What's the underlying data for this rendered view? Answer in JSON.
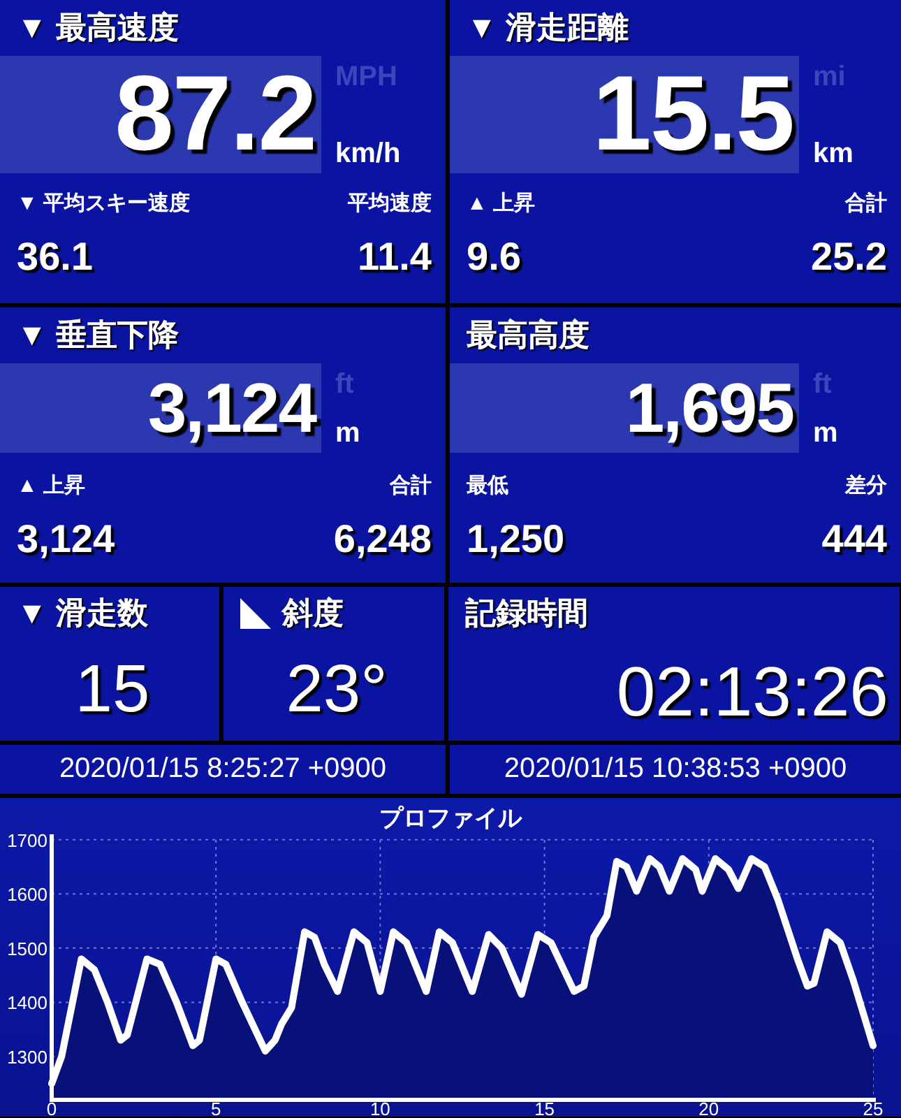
{
  "panels": [
    {
      "title": "▼ 最高速度",
      "value": "87.2",
      "alt_unit": "MPH",
      "unit": "km/h",
      "stats": [
        {
          "label": "▼ 平均スキー速度",
          "value": "36.1"
        },
        {
          "label": "平均速度",
          "value": "11.4"
        }
      ]
    },
    {
      "title": "▼ 滑走距離",
      "value": "15.5",
      "alt_unit": "mi",
      "unit": "km",
      "stats": [
        {
          "label": "▲ 上昇",
          "value": "9.6"
        },
        {
          "label": "合計",
          "value": "25.2"
        }
      ]
    },
    {
      "title": "▼ 垂直下降",
      "value": "3,124",
      "alt_unit": "ft",
      "unit": "m",
      "stats": [
        {
          "label": "▲ 上昇",
          "value": "3,124"
        },
        {
          "label": "合計",
          "value": "6,248"
        }
      ]
    },
    {
      "title": "最高高度",
      "value": "1,695",
      "alt_unit": "ft",
      "unit": "m",
      "stats": [
        {
          "label": "最低",
          "value": "1,250"
        },
        {
          "label": "差分",
          "value": "444"
        }
      ]
    }
  ],
  "small_panels": [
    {
      "kind": "count",
      "title": "▼ 滑走数",
      "value": "15"
    },
    {
      "kind": "slope",
      "title": "斜度",
      "value": "23°"
    },
    {
      "kind": "time",
      "title": "記録時間",
      "value": "02:13:26"
    }
  ],
  "timestamps": [
    "2020/01/15 8:25:27 +0900",
    "2020/01/15 10:38:53 +0900"
  ],
  "profile": {
    "chart_data": {
      "type": "area",
      "title": "プロファイル",
      "x": [
        0,
        0.3,
        0.9,
        1.3,
        1.7,
        2.1,
        2.3,
        2.9,
        3.3,
        3.8,
        4.3,
        4.5,
        5.0,
        5.3,
        5.8,
        6.5,
        6.8,
        7.0,
        7.3,
        7.7,
        8.0,
        8.3,
        8.7,
        9.2,
        9.6,
        10.0,
        10.4,
        10.8,
        11.4,
        11.8,
        12.2,
        12.8,
        13.3,
        13.7,
        14.3,
        14.8,
        15.2,
        15.9,
        16.2,
        16.5,
        16.9,
        17.2,
        17.5,
        17.8,
        18.2,
        18.5,
        18.8,
        19.2,
        19.6,
        19.8,
        20.2,
        20.6,
        20.9,
        21.3,
        21.7,
        22.1,
        22.7,
        23.0,
        23.2,
        23.6,
        24.0,
        24.4,
        25.0
      ],
      "series": [
        {
          "color": "#ffffff",
          "values": [
            1250,
            1300,
            1480,
            1460,
            1400,
            1330,
            1340,
            1480,
            1470,
            1400,
            1320,
            1330,
            1480,
            1470,
            1400,
            1310,
            1330,
            1360,
            1390,
            1530,
            1520,
            1470,
            1420,
            1530,
            1510,
            1420,
            1530,
            1510,
            1420,
            1530,
            1510,
            1420,
            1525,
            1500,
            1415,
            1525,
            1510,
            1420,
            1430,
            1520,
            1560,
            1660,
            1650,
            1605,
            1665,
            1650,
            1605,
            1665,
            1645,
            1605,
            1665,
            1645,
            1610,
            1665,
            1650,
            1590,
            1480,
            1430,
            1435,
            1530,
            1510,
            1440,
            1320
          ]
        }
      ],
      "grid": true,
      "xlim": [
        0,
        25
      ],
      "ylim": [
        1220,
        1710
      ],
      "xticks": [
        0,
        5,
        10,
        15,
        20,
        25
      ],
      "yticks": [
        1300,
        1400,
        1500,
        1600,
        1700
      ]
    }
  }
}
